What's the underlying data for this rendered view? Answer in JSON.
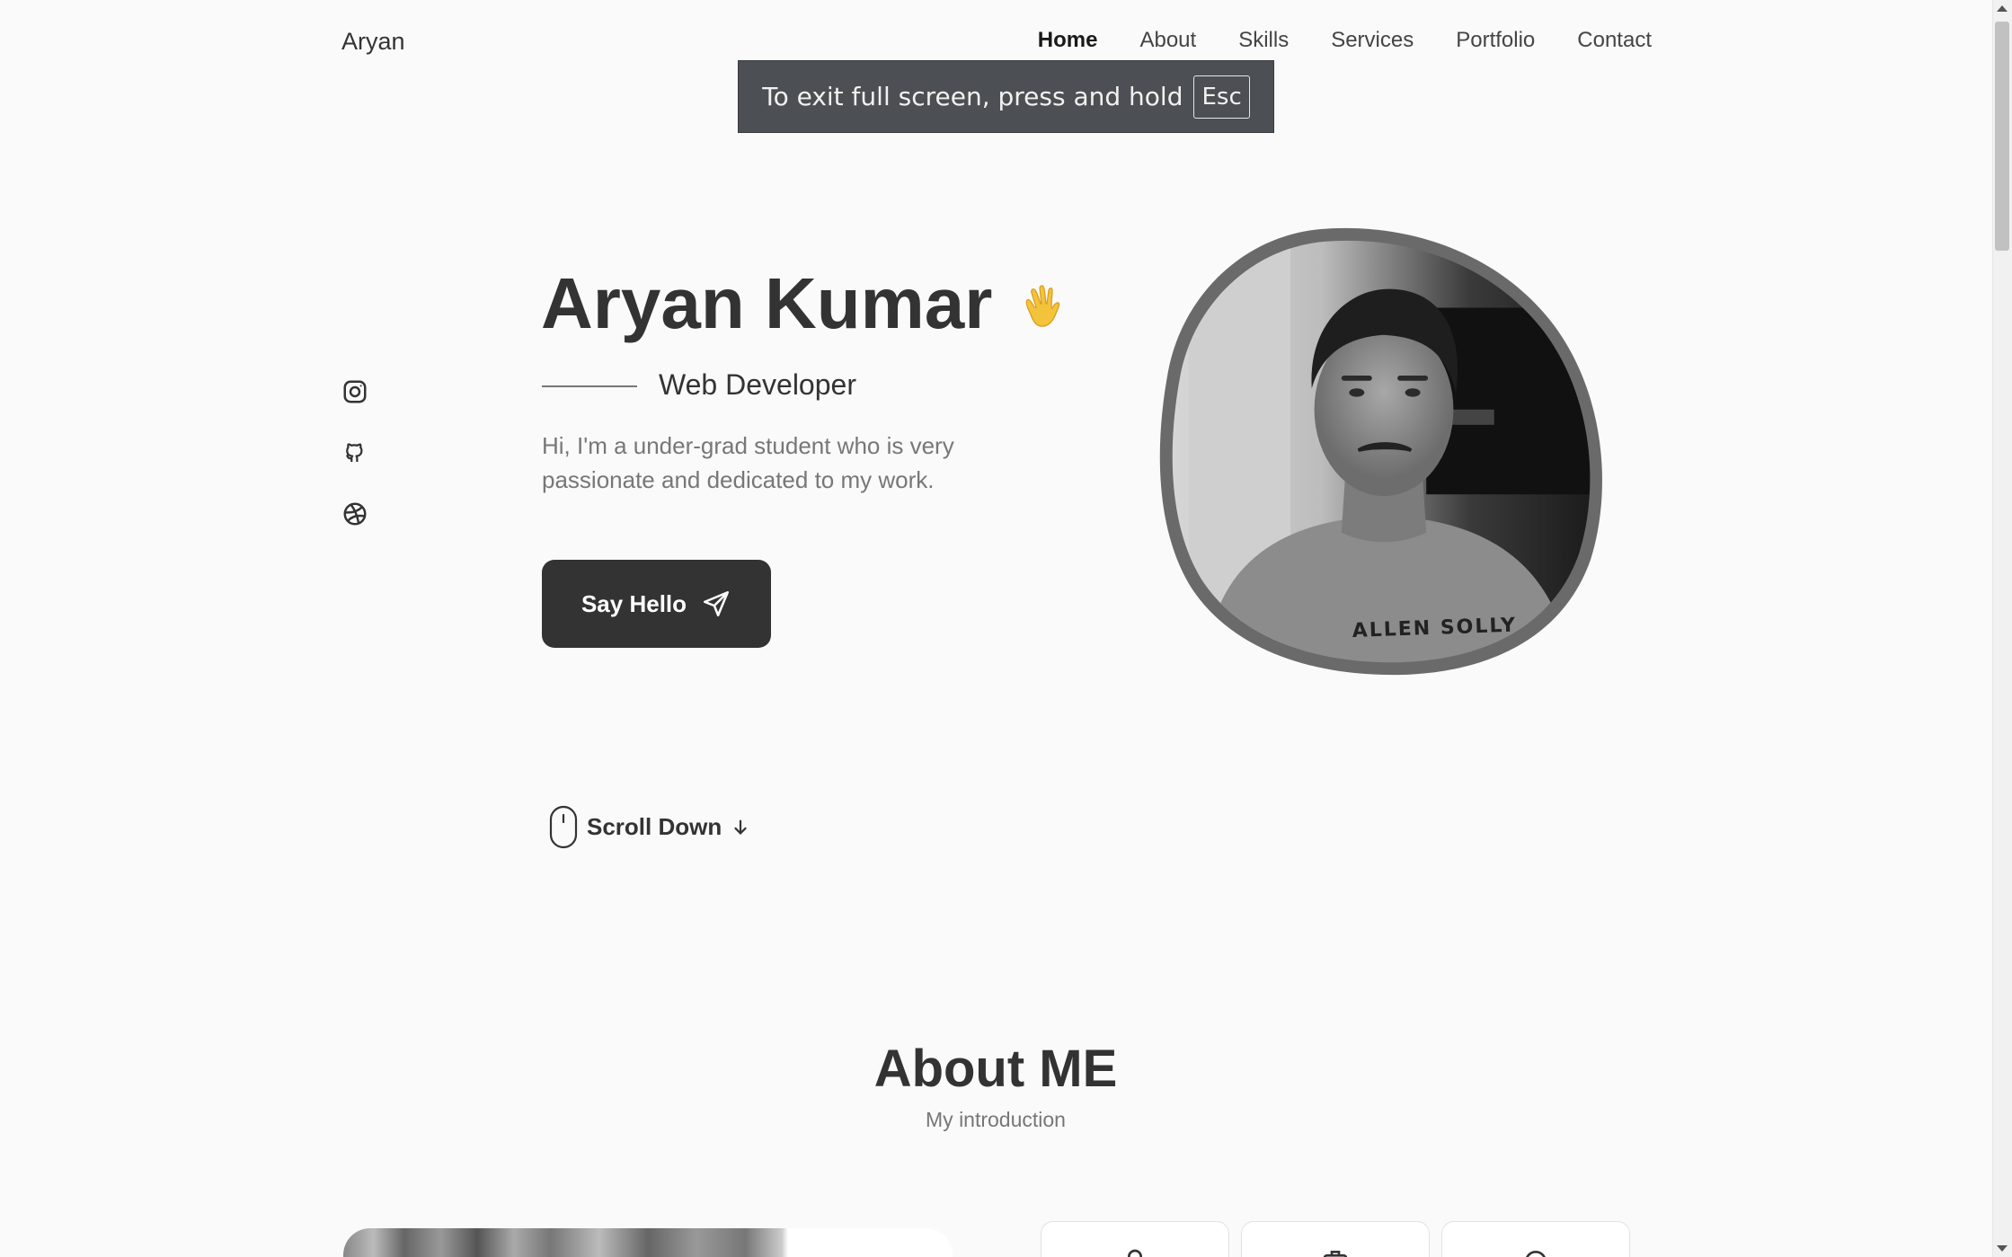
{
  "header": {
    "logo": "Aryan",
    "nav": [
      {
        "label": "Home",
        "active": true
      },
      {
        "label": "About",
        "active": false
      },
      {
        "label": "Skills",
        "active": false
      },
      {
        "label": "Services",
        "active": false
      },
      {
        "label": "Portfolio",
        "active": false
      },
      {
        "label": "Contact",
        "active": false
      }
    ]
  },
  "fullscreen_toast": {
    "message": "To exit full screen, press and hold",
    "key": "Esc"
  },
  "socials": [
    {
      "icon": "instagram-icon"
    },
    {
      "icon": "github-icon"
    },
    {
      "icon": "dribbble-icon"
    }
  ],
  "hero": {
    "name": "Aryan Kumar",
    "wave_icon": "waving-hand-icon",
    "role": "Web Developer",
    "intro": "Hi, I'm a under-grad student who is very passionate and dedicated to my work.",
    "cta_label": "Say Hello",
    "cta_icon": "send-icon",
    "photo_shirt_text": "ALLEN SOLLY"
  },
  "scroll_hint": {
    "label": "Scroll Down"
  },
  "about": {
    "title": "About ME",
    "subtitle": "My introduction"
  },
  "colors": {
    "background": "#fafafa",
    "text": "#333333",
    "muted": "#777777",
    "button": "#333333",
    "toast": "#4c4f53",
    "wave": "#f3c33b"
  }
}
